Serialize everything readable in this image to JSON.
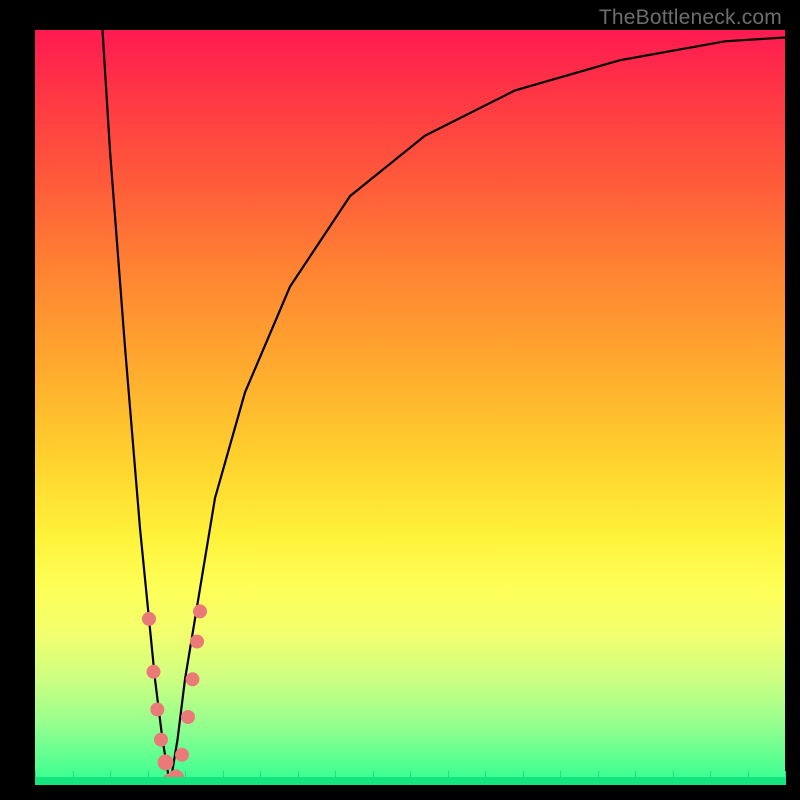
{
  "watermark": "TheBottleneck.com",
  "chart_data": {
    "type": "line",
    "title": "",
    "xlabel": "",
    "ylabel": "",
    "xlim": [
      0,
      100
    ],
    "ylim": [
      0,
      100
    ],
    "series": [
      {
        "name": "bottleneck-curve",
        "x": [
          9,
          10,
          12,
          14,
          16,
          17,
          18,
          19,
          20,
          22,
          24,
          28,
          34,
          42,
          52,
          64,
          78,
          92,
          100
        ],
        "values": [
          100,
          84,
          58,
          34,
          14,
          6,
          0,
          6,
          14,
          26,
          38,
          52,
          66,
          78,
          86,
          92,
          96,
          98.5,
          99
        ]
      }
    ],
    "markers": {
      "name": "highlight-points",
      "color": "#e97a78",
      "points": [
        {
          "x": 15.2,
          "y": 22
        },
        {
          "x": 15.8,
          "y": 15
        },
        {
          "x": 16.3,
          "y": 10
        },
        {
          "x": 16.8,
          "y": 6
        },
        {
          "x": 17.4,
          "y": 3
        },
        {
          "x": 18.0,
          "y": 0.5
        },
        {
          "x": 18.8,
          "y": 1
        },
        {
          "x": 19.6,
          "y": 4
        },
        {
          "x": 20.4,
          "y": 9
        },
        {
          "x": 21.0,
          "y": 14
        },
        {
          "x": 21.6,
          "y": 19
        },
        {
          "x": 22.0,
          "y": 23
        }
      ]
    },
    "gradient_stops": [
      {
        "pos": 0,
        "color": "#ff1a51"
      },
      {
        "pos": 45,
        "color": "#ffab2e"
      },
      {
        "pos": 74,
        "color": "#feff58"
      },
      {
        "pos": 100,
        "color": "#32ff93"
      }
    ]
  }
}
